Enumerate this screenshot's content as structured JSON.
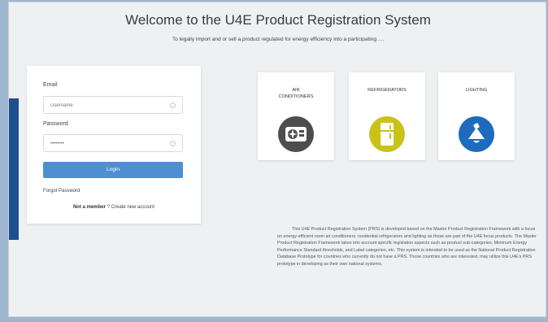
{
  "header": {
    "title": "Welcome to the U4E Product Registration System",
    "subtitle": "To legally import and or sell a product regulated for energy efficiency into a participating ...."
  },
  "login": {
    "email_label": "Email",
    "email_placeholder": "Username",
    "password_label": "Password",
    "password_placeholder": "••••••••",
    "login_button": "Login",
    "forgot_password": "Forgot Password",
    "not_member": "Not a member",
    "create_account": "? Create new account"
  },
  "categories": [
    {
      "label": "AIR\nCONDITIONERS",
      "icon": "air-conditioner-icon",
      "color": "#4d4d4d"
    },
    {
      "label": "REFRIGERATORS",
      "icon": "refrigerator-icon",
      "color": "#c9c219"
    },
    {
      "label": "LIGHTING",
      "icon": "lighting-icon",
      "color": "#1e6bbd"
    }
  ],
  "description": "This U4E Product Registration System (PRS) is developed based on the Master Product Registration Framework with a focus on energy-efficient room air conditioners, residential refrigerators and lighting as those are part of the U4E focus products. The Master Product Registration Framework takes into account specific legislation aspects such as product sub-categories, Minimum Energy Performance Standard thresholds, and Label categories, etc. This system is intended to be used as the National Product Registration Database Prototype for countries who currently do not have a PRS. Those countries who are interested, may utilize this U4E's PRS prototype in developing as their own national systems.",
  "colors": {
    "accent": "#1e4f8f",
    "button": "#4e8fd3"
  }
}
